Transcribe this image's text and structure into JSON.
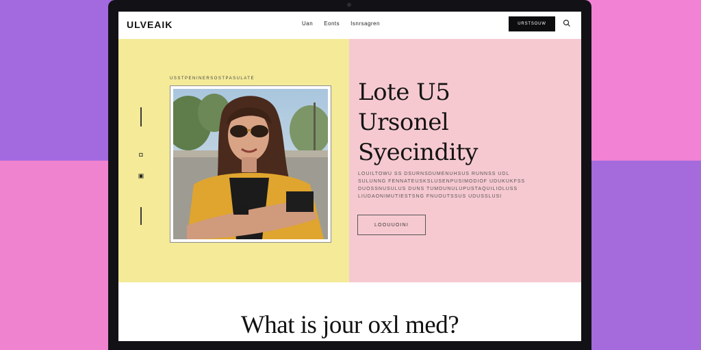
{
  "nav": {
    "logo": "ULVEAIK",
    "links": [
      "Uan",
      "Eonts",
      "Isnrsagren"
    ],
    "cta_label": "URSTSOUW"
  },
  "hero": {
    "eyebrow": "USSTPENINERSOSTPASULATE",
    "headline": [
      "Lote U5",
      "Ursonel",
      "Syecindity"
    ],
    "body": "LOUILTOWU SS DSURNSDUMENUHSUS RUNNSS UDL SULUNNG FENNATEUSKSLUSENPUSIMODIOF UDUKUKFSS DUOSSNUSULUS DUNS TUMDUNULUPUSTAQUILIOLUSS LIUDAONIMUTIESTSNG FNUOUTSSUS UDUSSLUSI",
    "button_label": "LOOUUOINI"
  },
  "section": {
    "question": "What is jour oxl med?"
  },
  "colors": {
    "hero_left_bg": "#f4ea98",
    "hero_right_bg": "#f6c9d0",
    "cta_bg": "#0d0d10"
  }
}
